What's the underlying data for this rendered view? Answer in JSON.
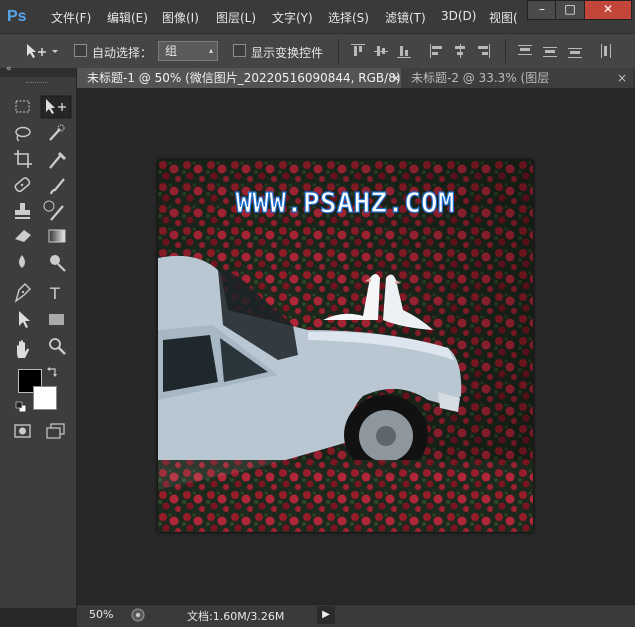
{
  "app": {
    "logo": "Ps"
  },
  "menu": [
    {
      "label": "文件(F)"
    },
    {
      "label": "编辑(E)"
    },
    {
      "label": "图像(I)"
    },
    {
      "label": "图层(L)"
    },
    {
      "label": "文字(Y)"
    },
    {
      "label": "选择(S)"
    },
    {
      "label": "滤镜(T)"
    },
    {
      "label": "3D(D)"
    },
    {
      "label": "视图("
    }
  ],
  "window": {
    "minimize": "–",
    "maximize": "□",
    "close": "✕"
  },
  "options": {
    "auto_select_label": "自动选择：",
    "group_value": "组",
    "show_transform_label": "显示变换控件"
  },
  "tabs": [
    {
      "label": "未标题-1 @ 50% (微信图片_20220516090844, RGB/8) *",
      "close": "×"
    },
    {
      "label": "未标题-2 @ 33.3% (图层",
      "close": "×"
    }
  ],
  "document": {
    "watermark": "WWW.PSAHZ.COM"
  },
  "colors": {
    "foreground": "#000000",
    "background": "#ffffff",
    "accent": "#56a5ec"
  },
  "status": {
    "zoom": "50%",
    "doc_info": "文档:1.60M/3.26M"
  }
}
